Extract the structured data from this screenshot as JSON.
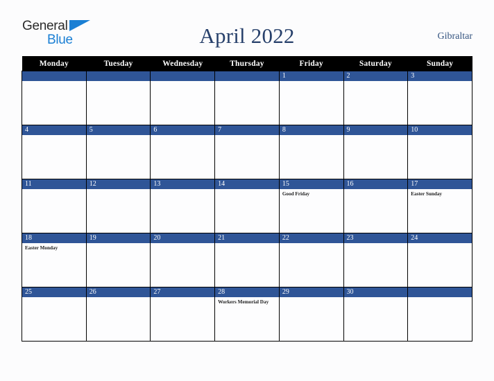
{
  "logo": {
    "word_one": "General",
    "word_two": "Blue",
    "triangle_icon": "blue-triangle-icon",
    "brand_blue": "#1a7fd4",
    "brand_dark": "#2b2b2b"
  },
  "header": {
    "title": "April 2022",
    "region": "Gibraltar",
    "title_color": "#27406b"
  },
  "calendar": {
    "month": "April",
    "year": "2022",
    "accent_blue": "#2f5597",
    "header_bg": "#000000",
    "weekday_headers": [
      "Monday",
      "Tuesday",
      "Wednesday",
      "Thursday",
      "Friday",
      "Saturday",
      "Sunday"
    ],
    "weeks": [
      [
        {
          "date": "",
          "events": []
        },
        {
          "date": "",
          "events": []
        },
        {
          "date": "",
          "events": []
        },
        {
          "date": "",
          "events": []
        },
        {
          "date": "1",
          "events": []
        },
        {
          "date": "2",
          "events": []
        },
        {
          "date": "3",
          "events": []
        }
      ],
      [
        {
          "date": "4",
          "events": []
        },
        {
          "date": "5",
          "events": []
        },
        {
          "date": "6",
          "events": []
        },
        {
          "date": "7",
          "events": []
        },
        {
          "date": "8",
          "events": []
        },
        {
          "date": "9",
          "events": []
        },
        {
          "date": "10",
          "events": []
        }
      ],
      [
        {
          "date": "11",
          "events": []
        },
        {
          "date": "12",
          "events": []
        },
        {
          "date": "13",
          "events": []
        },
        {
          "date": "14",
          "events": []
        },
        {
          "date": "15",
          "events": [
            "Good Friday"
          ]
        },
        {
          "date": "16",
          "events": []
        },
        {
          "date": "17",
          "events": [
            "Easter Sunday"
          ]
        }
      ],
      [
        {
          "date": "18",
          "events": [
            "Easter Monday"
          ]
        },
        {
          "date": "19",
          "events": []
        },
        {
          "date": "20",
          "events": []
        },
        {
          "date": "21",
          "events": []
        },
        {
          "date": "22",
          "events": []
        },
        {
          "date": "23",
          "events": []
        },
        {
          "date": "24",
          "events": []
        }
      ],
      [
        {
          "date": "25",
          "events": []
        },
        {
          "date": "26",
          "events": []
        },
        {
          "date": "27",
          "events": []
        },
        {
          "date": "28",
          "events": [
            "Workers Memorial Day"
          ]
        },
        {
          "date": "29",
          "events": []
        },
        {
          "date": "30",
          "events": []
        },
        {
          "date": "",
          "events": []
        }
      ]
    ]
  }
}
